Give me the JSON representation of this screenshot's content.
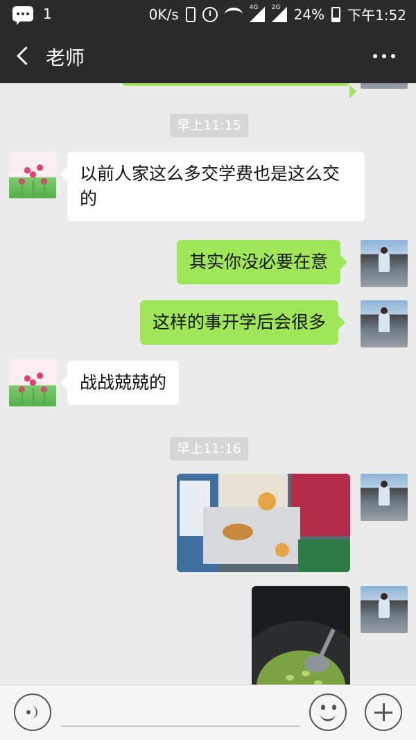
{
  "status_bar": {
    "notification_count": "1",
    "network_speed": "0K/s",
    "network_4g": "4G",
    "network_2g": "2G",
    "battery": "24%",
    "time": "下午1:52"
  },
  "header": {
    "title": "老师"
  },
  "chat": {
    "timestamps": [
      "早上11:15",
      "早上11:16"
    ],
    "messages": [
      {
        "sender": "teacher",
        "text": "以前人家这么多交学费也是这么交的"
      },
      {
        "sender": "me",
        "text": "其实你没必要在意"
      },
      {
        "sender": "me",
        "text": "这样的事开学后会很多"
      },
      {
        "sender": "teacher",
        "text": "战战兢兢的"
      }
    ]
  },
  "icons": {
    "back": "back-arrow-icon",
    "more": "more-dots-icon",
    "voice": "voice-icon",
    "emoji": "emoji-icon",
    "plus": "plus-icon"
  },
  "colors": {
    "header_bg": "#2b2b2b",
    "chat_bg": "#ebebeb",
    "my_bubble": "#9fe658",
    "their_bubble": "#ffffff"
  }
}
